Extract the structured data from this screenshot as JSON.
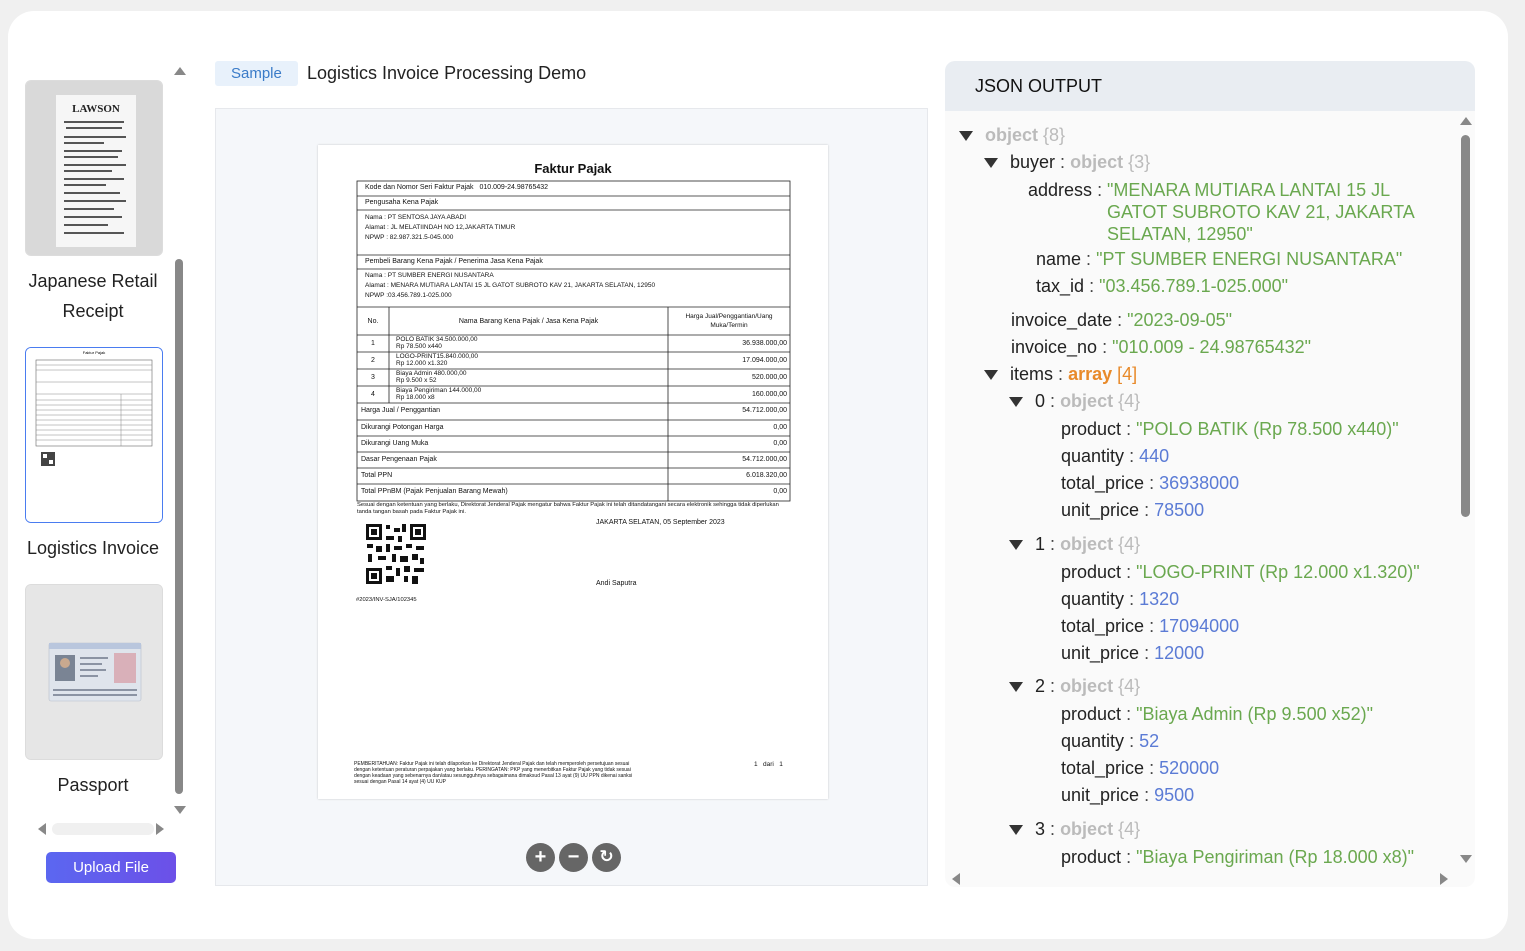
{
  "sidebar": {
    "items": [
      {
        "label": "Japanese Retail Receipt",
        "thumb_text": "LAWSON"
      },
      {
        "label": "Logistics Invoice",
        "thumb_text": "Faktur Pajak"
      },
      {
        "label": "Passport",
        "thumb_text": ""
      }
    ],
    "upload_label": "Upload File"
  },
  "viewer": {
    "tag": "Sample",
    "title": "Logistics Invoice Processing Demo",
    "zoom_in": "+",
    "zoom_out": "−",
    "reset": "↻"
  },
  "invoice": {
    "heading": "Faktur Pajak",
    "serial_label": "Kode dan Nomor Seri Faktur Pajak",
    "serial_value": "010.009-24.98765432",
    "seller_section": "Pengusaha Kena Pajak",
    "seller_name": "Nama : PT SENTOSA JAYA ABADI",
    "seller_address": "Alamat : JL MELATIINDAH NO 12,JAKARTA TIMUR",
    "seller_npwp": "NPWP : 82.987.321.5-045.000",
    "buyer_section": "Pembeli Barang Kena Pajak / Penerima Jasa Kena Pajak",
    "buyer_name": "Nama : PT SUMBER ENERGI NUSANTARA",
    "buyer_address": "Alamat : MENARA MUTIARA LANTAI 15 JL GATOT SUBROTO KAV 21, JAKARTA SELATAN, 12950",
    "buyer_npwp": "NPWP :03.456.789.1-025.000",
    "col_no": "No.",
    "col_name": "Nama Barang Kena Pajak / Jasa Kena Pajak",
    "col_price": "Harga Jual/Penggantian/Uang Muka/Termin",
    "lines": [
      {
        "no": "1",
        "desc1": "POLO BATIK 34.500.000,00",
        "desc2": "Rp 78.500 x440",
        "amount": "36.938.000,00"
      },
      {
        "no": "2",
        "desc1": "LOGO-PRINT15.840.000,00",
        "desc2": "Rp 12.000 x1.320",
        "amount": "17.094.000,00"
      },
      {
        "no": "3",
        "desc1": "Biaya Admin 480.000,00",
        "desc2": "Rp 9.500 x 52",
        "amount": "520.000,00"
      },
      {
        "no": "4",
        "desc1": "Biaya Pengiriman 144.000,00",
        "desc2": "Rp 18.000 x8",
        "amount": "160.000,00"
      }
    ],
    "totals": [
      {
        "label": "Harga Jual / Penggantian",
        "value": "54.712.000,00"
      },
      {
        "label": "Dikurangi Potongan Harga",
        "value": "0,00"
      },
      {
        "label": "Dikurangi Uang Muka",
        "value": "0,00"
      },
      {
        "label": "Dasar Pengenaan Pajak",
        "value": "54.712.000,00"
      },
      {
        "label": "Total PPN",
        "value": "6.018.320,00"
      },
      {
        "label": "Total PPnBM (Pajak Penjualan Barang Mewah)",
        "value": "0,00"
      }
    ],
    "notice": "Sesuai dengan ketentuan yang berlaku, Direktorat Jenderal Pajak mengatur bahwa Faktur Pajak ini telah ditandatangani secara elektronik sehingga tidak diperlukan tanda tangan basah pada Faktur Pajak ini.",
    "place_date": "JAKARTA SELATAN, 05 September 2023",
    "signer": "Andi Saputra",
    "ref": "#2023/INV-SJA/102345",
    "footer_note": "PEMBERITAHUAN: Faktur Pajak ini telah dilaporkan ke Direktorat Jenderal Pajak dan telah memperoleh persetujuan sesuai dengan ketentuan peraturan perpajakan yang berlaku. PERINGATAN: PKP yang menerbitkan Faktur Pajak yang tidak sesuai dengan keadaan yang sebenarnya dan/atau sesungguhnya sebagaimana dimaksud Pasal 13 ayat (9) UU PPN dikenai sanksi sesuai dengan Pasal 14 ayat (4) UU KUP",
    "page_info": "1   dari   1"
  },
  "json_panel": {
    "header": "JSON OUTPUT",
    "root_key": "object",
    "root_count": "{8}",
    "buyer_key": "buyer",
    "buyer_type": "object",
    "buyer_count": "{3}",
    "address_key": "address",
    "address_line1": "\"MENARA MUTIARA LANTAI 15 JL",
    "address_line2": "GATOT SUBROTO KAV 21, JAKARTA",
    "address_line3": "SELATAN, 12950\"",
    "name_key": "name",
    "name_value": "\"PT SUMBER ENERGI NUSANTARA\"",
    "tax_key": "tax_id",
    "tax_value": "\"03.456.789.1-025.000\"",
    "date_key": "invoice_date",
    "date_value": "\"2023-09-05\"",
    "no_key": "invoice_no",
    "no_value": "\"010.009 - 24.98765432\"",
    "items_key": "items",
    "items_type": "array",
    "items_count": "[4]",
    "obj_type": "object",
    "obj_count": "{4}",
    "k_product": "product",
    "k_quantity": "quantity",
    "k_total": "total_price",
    "k_unit": "unit_price",
    "items": [
      {
        "index": "0",
        "product": "\"POLO BATIK (Rp 78.500 x440)\"",
        "quantity": "440",
        "total_price": "36938000",
        "unit_price": "78500"
      },
      {
        "index": "1",
        "product": "\"LOGO-PRINT (Rp 12.000 x1.320)\"",
        "quantity": "1320",
        "total_price": "17094000",
        "unit_price": "12000"
      },
      {
        "index": "2",
        "product": "\"Biaya Admin (Rp 9.500 x52)\"",
        "quantity": "52",
        "total_price": "520000",
        "unit_price": "9500"
      },
      {
        "index": "3",
        "product": "\"Biaya Pengiriman (Rp 18.000 x8)\""
      }
    ],
    "colon": ":"
  }
}
